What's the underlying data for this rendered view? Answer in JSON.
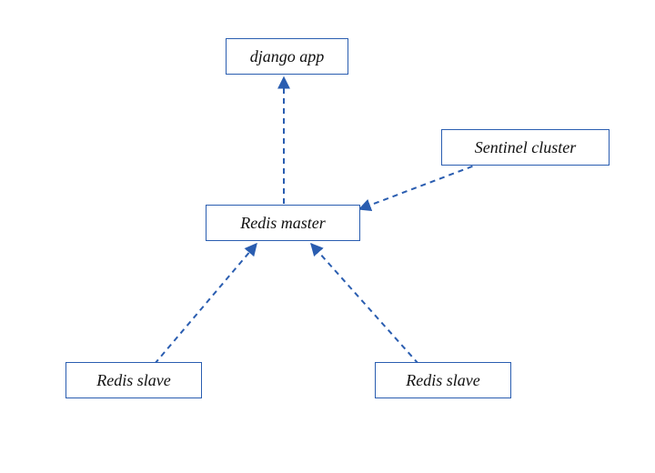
{
  "diagram": {
    "nodes": {
      "django_app": {
        "label": "django app"
      },
      "redis_master": {
        "label": "Redis master"
      },
      "sentinel_cluster": {
        "label": "Sentinel cluster"
      },
      "redis_slave_left": {
        "label": "Redis slave"
      },
      "redis_slave_right": {
        "label": "Redis slave"
      }
    },
    "edges": [
      {
        "from": "redis_master",
        "to": "django_app",
        "style": "dashed"
      },
      {
        "from": "sentinel_cluster",
        "to": "redis_master",
        "style": "dashed"
      },
      {
        "from": "redis_slave_left",
        "to": "redis_master",
        "style": "dashed"
      },
      {
        "from": "redis_slave_right",
        "to": "redis_master",
        "style": "dashed"
      }
    ],
    "style": {
      "stroke": "#2a5db0",
      "dash": "6 5",
      "stroke_width": 2
    }
  }
}
